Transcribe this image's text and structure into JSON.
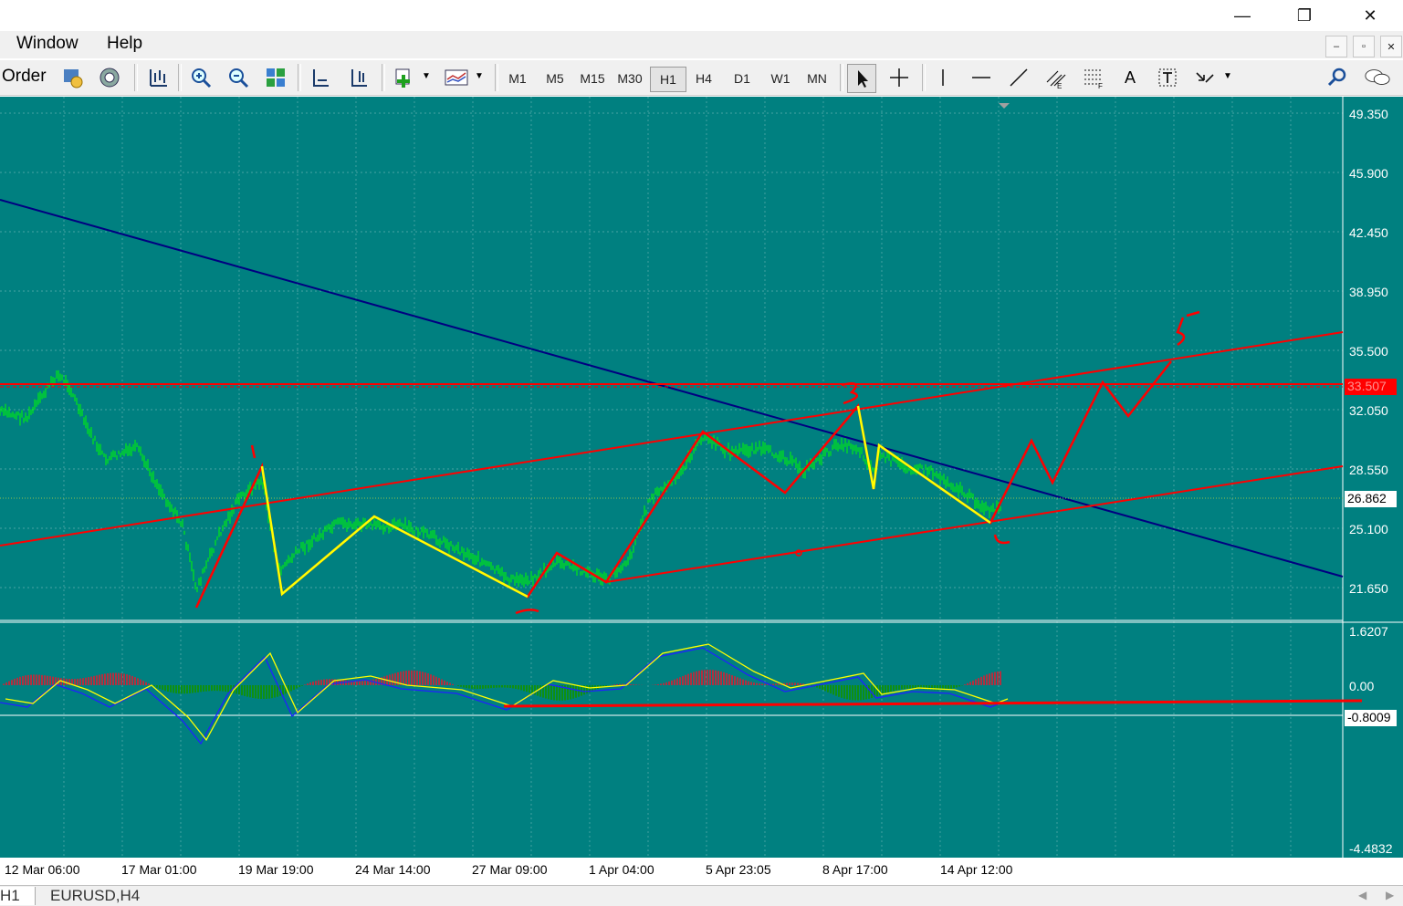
{
  "menu": {
    "window": "Window",
    "help": "Help"
  },
  "window_controls": {
    "minimize": "—",
    "restore": "❐",
    "close": "✕"
  },
  "mdi_controls": {
    "minimize": "–",
    "restore": "▫",
    "close": "✕"
  },
  "toolbar": {
    "order_label": "Order",
    "timeframes": [
      "M1",
      "M5",
      "M15",
      "M30",
      "H1",
      "H4",
      "D1",
      "W1",
      "MN"
    ],
    "active_timeframe": "H1",
    "text_tool": "A"
  },
  "price_axis": {
    "labels": [
      "49.350",
      "45.900",
      "42.450",
      "38.950",
      "35.500",
      "32.050",
      "28.550",
      "25.100",
      "21.650"
    ],
    "current_price": "33.507",
    "bid_line": "26.862"
  },
  "indicator_axis": {
    "labels": [
      "1.6207",
      "0.00",
      "-4.4832"
    ],
    "level_label": "-0.8009"
  },
  "time_axis": {
    "labels": [
      "12 Mar 06:00",
      "17 Mar 01:00",
      "19 Mar 19:00",
      "24 Mar 14:00",
      "27 Mar 09:00",
      "1 Apr 04:00",
      "5 Apr 23:05",
      "8 Apr 17:00",
      "14 Apr 12:00"
    ]
  },
  "tabs": {
    "first": "H1",
    "second": "EURUSD,H4"
  },
  "colors": {
    "chart_bg": "#008080",
    "candles": "#00ff00",
    "trend_line": "#000080",
    "annotation": "#ff0000",
    "wave": "#ffff00",
    "current_price_bg": "#ff0000"
  }
}
